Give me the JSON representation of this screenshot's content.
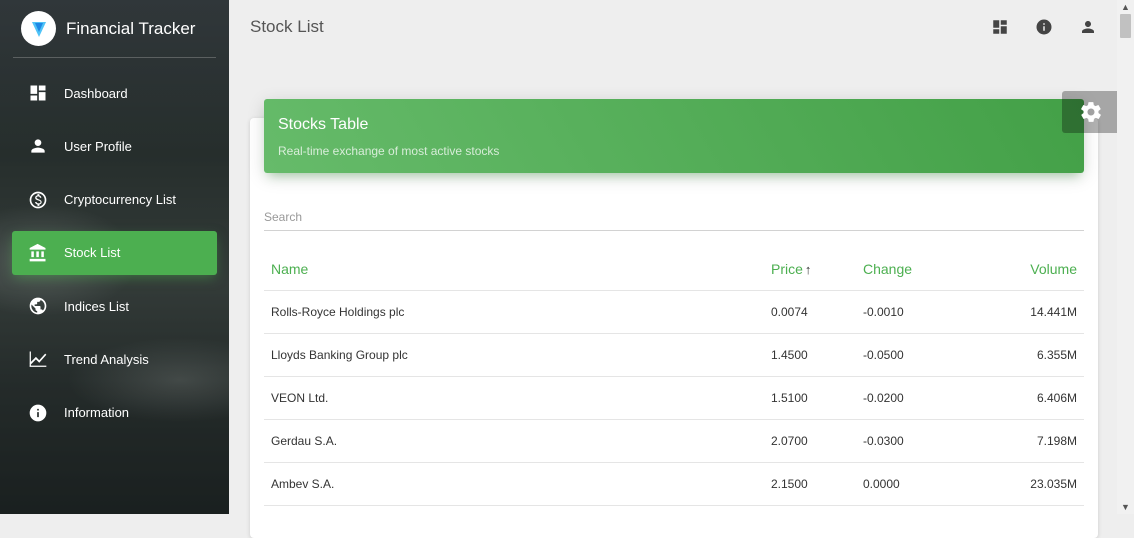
{
  "app": {
    "title": "Financial Tracker"
  },
  "sidebar": {
    "items": [
      {
        "label": "Dashboard",
        "icon": "dashboard-icon"
      },
      {
        "label": "User Profile",
        "icon": "person-icon"
      },
      {
        "label": "Cryptocurrency List",
        "icon": "coin-icon"
      },
      {
        "label": "Stock List",
        "icon": "bank-icon",
        "active": true
      },
      {
        "label": "Indices List",
        "icon": "globe-icon"
      },
      {
        "label": "Trend Analysis",
        "icon": "trending-icon"
      },
      {
        "label": "Information",
        "icon": "info-icon"
      }
    ]
  },
  "header": {
    "page_title": "Stock List",
    "icons": [
      "dashboard-icon",
      "info-icon",
      "person-icon"
    ]
  },
  "card": {
    "title": "Stocks Table",
    "subtitle": "Real-time exchange of most active stocks",
    "search_placeholder": "Search"
  },
  "table": {
    "columns": [
      "Name",
      "Price",
      "Change",
      "Volume"
    ],
    "sort": {
      "column": "Price",
      "direction": "ascending",
      "arrow": "↑"
    },
    "rows": [
      {
        "name": "Rolls-Royce Holdings plc",
        "price": "0.0074",
        "change": "-0.0010",
        "volume": "14.441M"
      },
      {
        "name": "Lloyds Banking Group plc",
        "price": "1.4500",
        "change": "-0.0500",
        "volume": "6.355M"
      },
      {
        "name": "VEON Ltd.",
        "price": "1.5100",
        "change": "-0.0200",
        "volume": "6.406M"
      },
      {
        "name": "Gerdau S.A.",
        "price": "2.0700",
        "change": "-0.0300",
        "volume": "7.198M"
      },
      {
        "name": "Ambev S.A.",
        "price": "2.1500",
        "change": "0.0000",
        "volume": "23.035M"
      }
    ]
  },
  "colors": {
    "accent": "#4caf50",
    "accent_dark": "#43a047"
  }
}
